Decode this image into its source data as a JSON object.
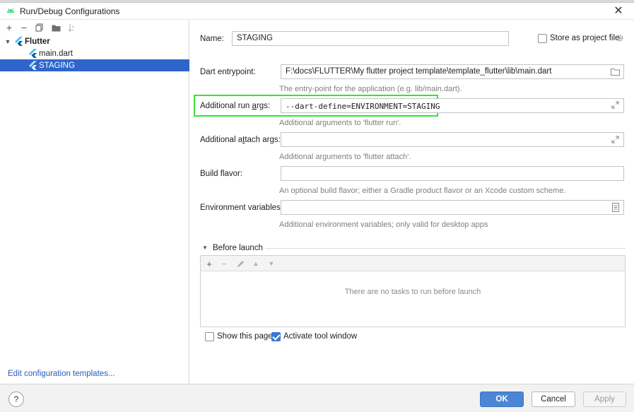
{
  "window": {
    "title": "Run/Debug Configurations"
  },
  "tree": {
    "group": "Flutter",
    "items": [
      {
        "label": "main.dart"
      },
      {
        "label": "STAGING"
      }
    ]
  },
  "left_footer": {
    "edit_templates": "Edit configuration templates..."
  },
  "form": {
    "name_label": "Name:",
    "name_value": "STAGING",
    "store_label": "Store as project file",
    "entry_label": "Dart entrypoint:",
    "entry_value": "F:\\docs\\FLUTTER\\My flutter project template\\template_flutter\\lib\\main.dart",
    "entry_hint": "The entry-point for the application (e.g. lib/main.dart).",
    "run_args_label": "Additional run args:",
    "run_args_value": "--dart-define=ENVIRONMENT=STAGING",
    "run_args_hint": "Additional arguments to 'flutter run'.",
    "attach_label": "Additional attach args:",
    "attach_value": "",
    "attach_hint": "Additional arguments to 'flutter attach'.",
    "flavor_label": "Build flavor:",
    "flavor_value": "",
    "flavor_hint": "An optional build flavor; either a Gradle product flavor or an Xcode custom scheme.",
    "env_label": "Environment variables:",
    "env_value": "",
    "env_hint": "Additional environment variables; only valid for desktop apps"
  },
  "before_launch": {
    "title": "Before launch",
    "empty_text": "There are no tasks to run before launch"
  },
  "options": {
    "show_page": {
      "label": "Show this page",
      "checked": false
    },
    "activate_tool": {
      "label": "Activate tool window",
      "checked": true
    }
  },
  "buttons": {
    "help": "?",
    "ok": "OK",
    "cancel": "Cancel",
    "apply": "Apply"
  },
  "colors": {
    "accent": "#2f65ca",
    "highlight": "#35e431",
    "primary_button": "#4a86d4"
  }
}
